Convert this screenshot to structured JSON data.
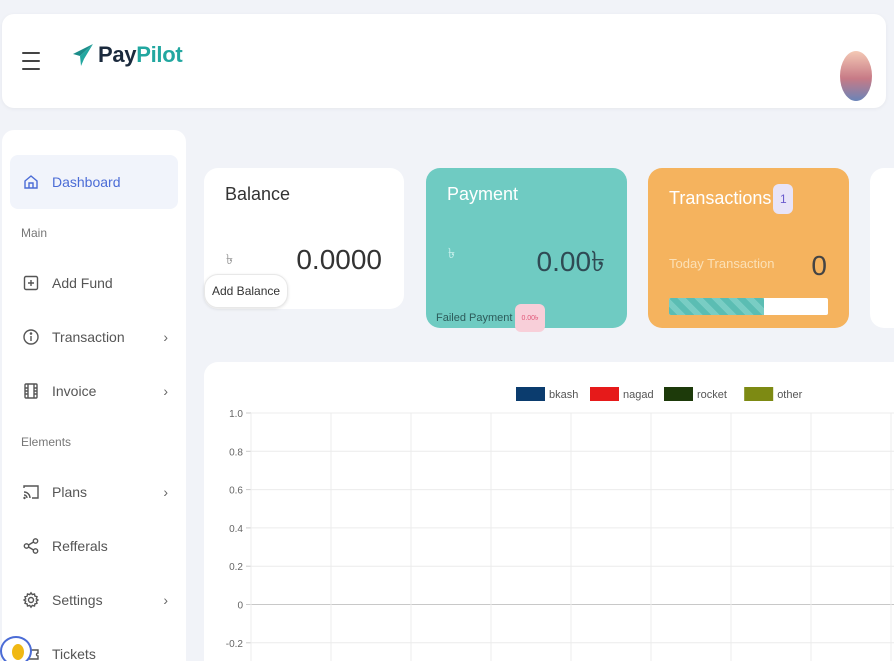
{
  "brand": {
    "name_part1": "Pay",
    "name_part2": "Pilot"
  },
  "sidebar": {
    "items": [
      {
        "label": "Dashboard"
      },
      {
        "label": "Add Fund"
      },
      {
        "label": "Transaction"
      },
      {
        "label": "Invoice"
      },
      {
        "label": "Plans"
      },
      {
        "label": "Refferals"
      },
      {
        "label": "Settings"
      },
      {
        "label": "Tickets"
      }
    ],
    "sections": {
      "main": "Main",
      "elements": "Elements"
    }
  },
  "cards": {
    "balance": {
      "title": "Balance",
      "currency": "৳",
      "value": "0.0000",
      "button": "Add Balance"
    },
    "payment": {
      "title": "Payment",
      "currency": "৳",
      "value": "0.00৳",
      "failed_label": "Failed Payment",
      "failed_value": "0.00৳"
    },
    "transactions": {
      "title": "Transactions",
      "badge": "1",
      "today_label": "Today Transaction",
      "today_value": "0",
      "progress": 0.6
    }
  },
  "chart_data": {
    "type": "line",
    "series": [
      {
        "name": "bkash",
        "color": "#0b3c6e",
        "values": []
      },
      {
        "name": "nagad",
        "color": "#e61a1a",
        "values": []
      },
      {
        "name": "rocket",
        "color": "#1d3a0a",
        "values": []
      },
      {
        "name": "other",
        "color": "#7d8a13",
        "values": []
      }
    ],
    "yticks": [
      "1.0",
      "0.8",
      "0.6",
      "0.4",
      "0.2",
      "0",
      "-0.2"
    ],
    "ylim": [
      -0.2,
      1.0
    ],
    "grid": true,
    "legend": "top"
  }
}
